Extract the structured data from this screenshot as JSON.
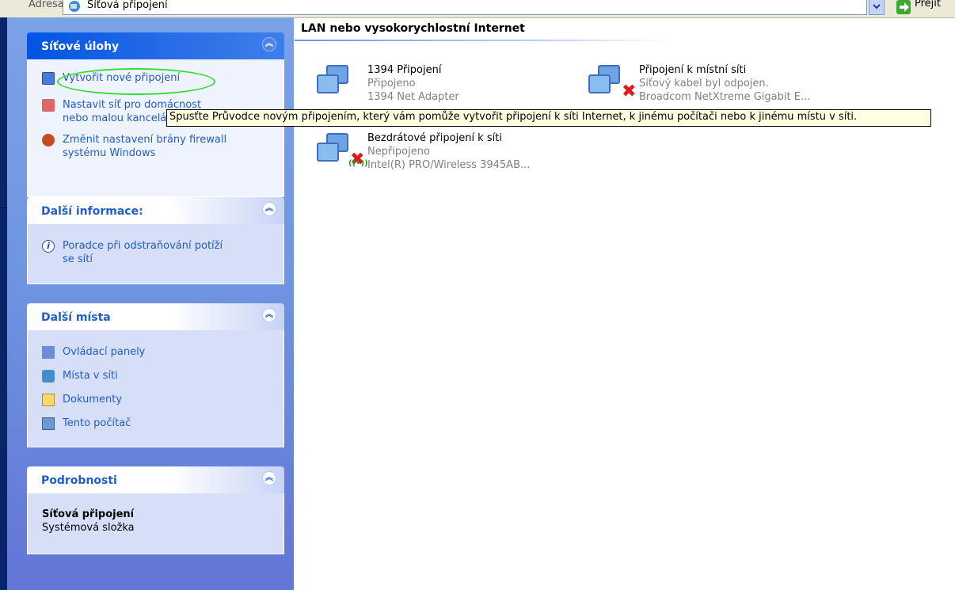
{
  "addressbar": {
    "label": "Adresa",
    "value": "Síťová připojení",
    "go_label": "Přejít"
  },
  "panels": {
    "tasks": {
      "title": "Síťové úlohy",
      "items": [
        {
          "label": "Vytvořit nové připojení",
          "icon": "new-connection-icon"
        },
        {
          "label_line1": "Nastavit síť pro domácnost",
          "label_line2": "nebo malou kancelář",
          "icon": "home-network-icon"
        },
        {
          "label_line1": "Změnit nastavení brány firewall",
          "label_line2": "systému Windows",
          "icon": "firewall-icon"
        }
      ]
    },
    "info": {
      "title": "Další informace:",
      "items": [
        {
          "label_line1": "Poradce při odstraňování potíží",
          "label_line2": "se sítí",
          "icon": "info-icon"
        }
      ]
    },
    "places": {
      "title": "Další místa",
      "items": [
        {
          "label": "Ovládací panely",
          "icon": "control-panel-icon"
        },
        {
          "label": "Místa v síti",
          "icon": "network-places-icon"
        },
        {
          "label": "Dokumenty",
          "icon": "documents-icon"
        },
        {
          "label": "Tento počítač",
          "icon": "my-computer-icon"
        }
      ]
    },
    "details": {
      "title": "Podrobnosti",
      "name": "Síťová připojení",
      "type": "Systémová složka"
    }
  },
  "content": {
    "group_title": "LAN nebo vysokorychlostní Internet",
    "connections": [
      {
        "name": "1394 Připojení",
        "status": "Připojeno",
        "adapter": "1394 Net Adapter"
      },
      {
        "name": "Připojení k místní síti",
        "status": "Síťový kabel byl odpojen.",
        "adapter": "Broadcom NetXtreme Gigabit E..."
      },
      {
        "name": "Bezdrátové připojení k síti",
        "status": "Nepřipojeno",
        "adapter": "Intel(R) PRO/Wireless 3945AB..."
      }
    ]
  },
  "tooltip": "Spusťte Průvodce novým připojením, který vám pomůže vytvořit připojení k síti Internet, k jinému počítači nebo k jinému místu v síti.",
  "colors": {
    "link": "#215dc6",
    "tooltip_bg": "#ffffe1",
    "highlight": "#2fe02f",
    "error": "#e01b1b"
  }
}
